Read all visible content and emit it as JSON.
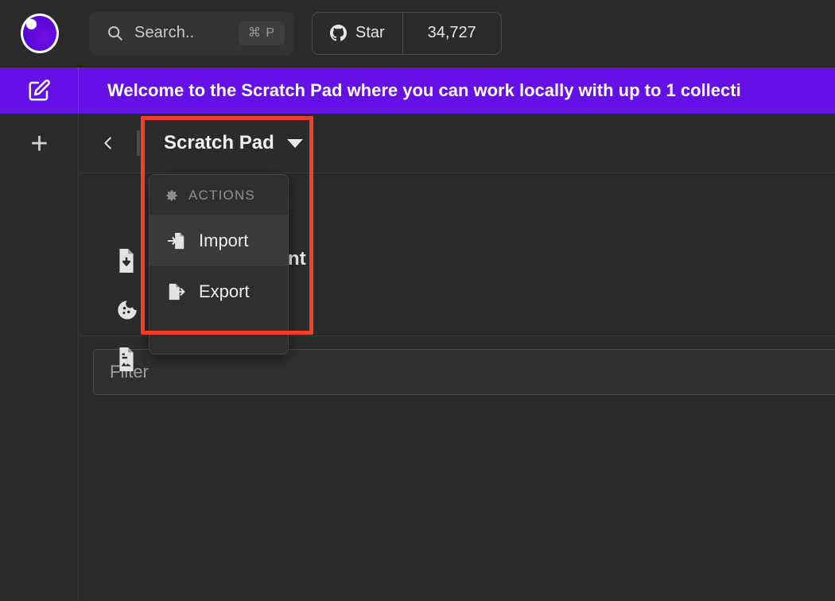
{
  "app": {
    "logo_name": "insomnia-logo",
    "accent_purple": "#6610e8",
    "annotation_color": "#f04123",
    "background": "#2b2b2b"
  },
  "header": {
    "search": {
      "placeholder": "Search..",
      "shortcut": "⌘ P",
      "icon": "search-icon"
    },
    "github_star": {
      "icon": "github-icon",
      "label": "Star",
      "count": "34,727"
    }
  },
  "banner": {
    "icon": "edit-square-icon",
    "message": "Welcome to the Scratch Pad where you can work locally with up to 1 collecti"
  },
  "rail": {
    "add_label": "+",
    "add_name": "add-workspace-button"
  },
  "panel": {
    "back_icon": "chevron-left-icon",
    "title": "Scratch Pad",
    "caret_icon": "chevron-down-icon",
    "obscured_label": "nt",
    "side_icons": [
      {
        "name": "file-import-icon"
      },
      {
        "name": "cookie-icon"
      },
      {
        "name": "file-code-icon"
      }
    ],
    "filter": {
      "placeholder": "Filter",
      "value": ""
    }
  },
  "menu": {
    "section_label": "ACTIONS",
    "section_icon": "gear-icon",
    "items": [
      {
        "label": "Import",
        "icon": "import-icon",
        "hovered": true
      },
      {
        "label": "Export",
        "icon": "export-icon",
        "hovered": false
      }
    ]
  }
}
